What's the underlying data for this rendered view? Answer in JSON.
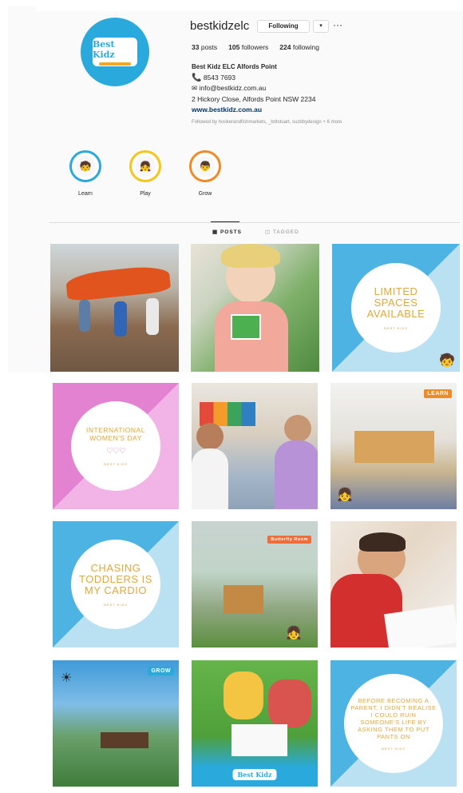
{
  "profile": {
    "username": "bestkidzelc",
    "following_button": "Following",
    "caret": "▾",
    "more": "···",
    "logo_word": "Best Kidz",
    "stats": [
      {
        "value": "33",
        "label": "posts"
      },
      {
        "value": "105",
        "label": "followers"
      },
      {
        "value": "224",
        "label": "following"
      }
    ],
    "bio": {
      "name": "Best Kidz ELC Alfords Point",
      "phone": "8543 7693",
      "email": "info@bestkidz.com.au",
      "address": "2 Hickory Close, Alfords Point NSW 2234",
      "website": "www.bestkidz.com.au"
    },
    "followed_by": "Followed by hookerandfishmarkets, _britstuart, suzbbydesign + 6 more"
  },
  "highlights": [
    {
      "label": "Learn",
      "ring_color": "#2aa9dd",
      "icon": "child-icon"
    },
    {
      "label": "Play",
      "ring_color": "#f5c518",
      "icon": "child-icon"
    },
    {
      "label": "Grow",
      "ring_color": "#f08a24",
      "icon": "child-icon"
    }
  ],
  "tabs": {
    "posts": "▦ POSTS",
    "tagged": "◫ TAGGED"
  },
  "grid": {
    "tile_limited": {
      "text": "LIMITED SPACES AVAILABLE",
      "sig": "BEST KIDZ"
    },
    "tile_womens": {
      "text": "INTERNATIONAL WOMEN'S DAY",
      "hearts": "♡♡♡",
      "sig": "BEST KIDZ"
    },
    "tile_chasing": {
      "text": "CHASING TODDLERS IS MY CARDIO",
      "sig": "BEST KIDZ"
    },
    "tile_parent": {
      "text": "BEFORE BECOMING A PARENT, I DIDN'T REALISE I COULD RUIN SOMEONE'S LIFE BY ASKING THEM TO PUT PANTS ON",
      "sig": "BEST KIDZ"
    },
    "badge_learn": "LEARN",
    "badge_grow": "GROW",
    "badge_butterfly": "Butterfly Room",
    "logo_word": "Best Kidz"
  }
}
